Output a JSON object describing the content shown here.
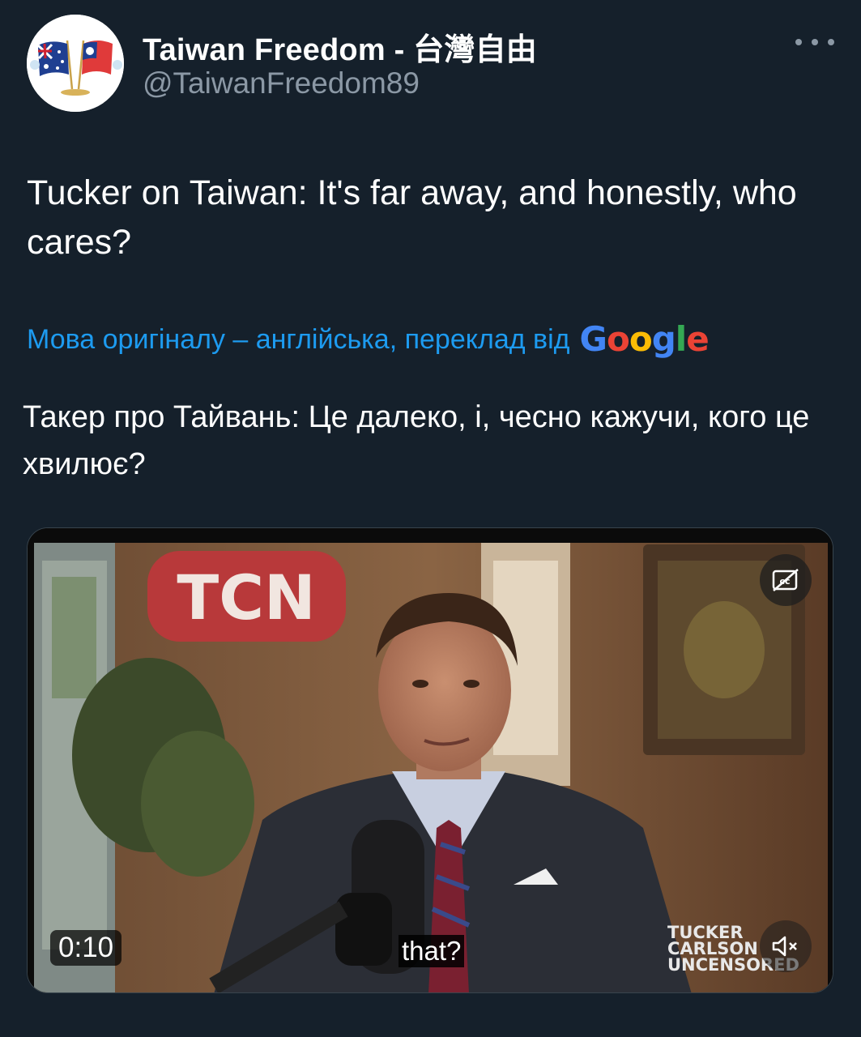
{
  "author": {
    "display_name": "Taiwan Freedom - 台灣自由",
    "handle": "@TaiwanFreedom89"
  },
  "tweet": {
    "text": "Tucker on Taiwan: It's far away, and honestly, who cares?"
  },
  "translation": {
    "notice": "Мова оригіналу – англійська, переклад від",
    "provider_letters": [
      "G",
      "o",
      "o",
      "g",
      "l",
      "e"
    ],
    "text": "Такер про Тайвань: Це далеко, і, чесно кажучи, кого це хвилює?"
  },
  "video": {
    "channel_sign": "TCN",
    "time": "0:10",
    "caption": "that?",
    "show_logo_lines": [
      "TUCKER",
      "CARLSON",
      "UNCENSORED"
    ],
    "muted": true
  },
  "icons": {
    "more": "more-horizontal-icon",
    "captions": "closed-captions-icon",
    "mute": "volume-muted-icon"
  },
  "colors": {
    "background": "#15202b",
    "link": "#1d9bf0",
    "secondary_text": "#8b98a5"
  }
}
